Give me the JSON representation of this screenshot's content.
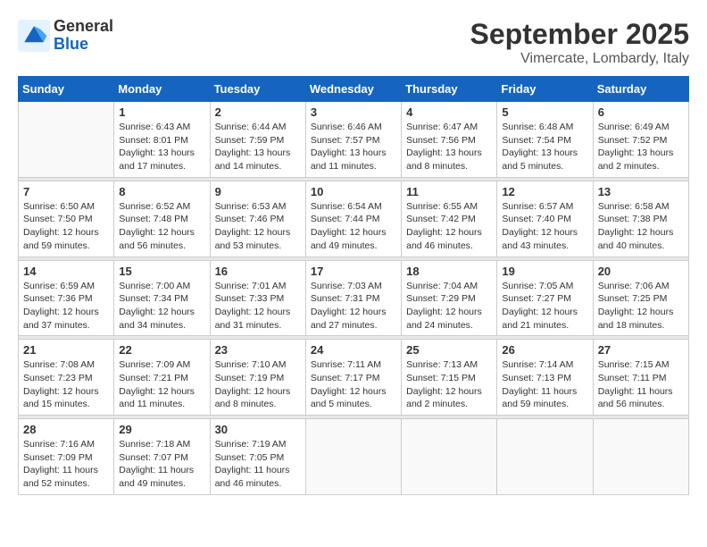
{
  "logo": {
    "general": "General",
    "blue": "Blue"
  },
  "title": "September 2025",
  "subtitle": "Vimercate, Lombardy, Italy",
  "days_of_week": [
    "Sunday",
    "Monday",
    "Tuesday",
    "Wednesday",
    "Thursday",
    "Friday",
    "Saturday"
  ],
  "weeks": [
    [
      {
        "day": "",
        "info": ""
      },
      {
        "day": "1",
        "info": "Sunrise: 6:43 AM\nSunset: 8:01 PM\nDaylight: 13 hours\nand 17 minutes."
      },
      {
        "day": "2",
        "info": "Sunrise: 6:44 AM\nSunset: 7:59 PM\nDaylight: 13 hours\nand 14 minutes."
      },
      {
        "day": "3",
        "info": "Sunrise: 6:46 AM\nSunset: 7:57 PM\nDaylight: 13 hours\nand 11 minutes."
      },
      {
        "day": "4",
        "info": "Sunrise: 6:47 AM\nSunset: 7:56 PM\nDaylight: 13 hours\nand 8 minutes."
      },
      {
        "day": "5",
        "info": "Sunrise: 6:48 AM\nSunset: 7:54 PM\nDaylight: 13 hours\nand 5 minutes."
      },
      {
        "day": "6",
        "info": "Sunrise: 6:49 AM\nSunset: 7:52 PM\nDaylight: 13 hours\nand 2 minutes."
      }
    ],
    [
      {
        "day": "7",
        "info": "Sunrise: 6:50 AM\nSunset: 7:50 PM\nDaylight: 12 hours\nand 59 minutes."
      },
      {
        "day": "8",
        "info": "Sunrise: 6:52 AM\nSunset: 7:48 PM\nDaylight: 12 hours\nand 56 minutes."
      },
      {
        "day": "9",
        "info": "Sunrise: 6:53 AM\nSunset: 7:46 PM\nDaylight: 12 hours\nand 53 minutes."
      },
      {
        "day": "10",
        "info": "Sunrise: 6:54 AM\nSunset: 7:44 PM\nDaylight: 12 hours\nand 49 minutes."
      },
      {
        "day": "11",
        "info": "Sunrise: 6:55 AM\nSunset: 7:42 PM\nDaylight: 12 hours\nand 46 minutes."
      },
      {
        "day": "12",
        "info": "Sunrise: 6:57 AM\nSunset: 7:40 PM\nDaylight: 12 hours\nand 43 minutes."
      },
      {
        "day": "13",
        "info": "Sunrise: 6:58 AM\nSunset: 7:38 PM\nDaylight: 12 hours\nand 40 minutes."
      }
    ],
    [
      {
        "day": "14",
        "info": "Sunrise: 6:59 AM\nSunset: 7:36 PM\nDaylight: 12 hours\nand 37 minutes."
      },
      {
        "day": "15",
        "info": "Sunrise: 7:00 AM\nSunset: 7:34 PM\nDaylight: 12 hours\nand 34 minutes."
      },
      {
        "day": "16",
        "info": "Sunrise: 7:01 AM\nSunset: 7:33 PM\nDaylight: 12 hours\nand 31 minutes."
      },
      {
        "day": "17",
        "info": "Sunrise: 7:03 AM\nSunset: 7:31 PM\nDaylight: 12 hours\nand 27 minutes."
      },
      {
        "day": "18",
        "info": "Sunrise: 7:04 AM\nSunset: 7:29 PM\nDaylight: 12 hours\nand 24 minutes."
      },
      {
        "day": "19",
        "info": "Sunrise: 7:05 AM\nSunset: 7:27 PM\nDaylight: 12 hours\nand 21 minutes."
      },
      {
        "day": "20",
        "info": "Sunrise: 7:06 AM\nSunset: 7:25 PM\nDaylight: 12 hours\nand 18 minutes."
      }
    ],
    [
      {
        "day": "21",
        "info": "Sunrise: 7:08 AM\nSunset: 7:23 PM\nDaylight: 12 hours\nand 15 minutes."
      },
      {
        "day": "22",
        "info": "Sunrise: 7:09 AM\nSunset: 7:21 PM\nDaylight: 12 hours\nand 11 minutes."
      },
      {
        "day": "23",
        "info": "Sunrise: 7:10 AM\nSunset: 7:19 PM\nDaylight: 12 hours\nand 8 minutes."
      },
      {
        "day": "24",
        "info": "Sunrise: 7:11 AM\nSunset: 7:17 PM\nDaylight: 12 hours\nand 5 minutes."
      },
      {
        "day": "25",
        "info": "Sunrise: 7:13 AM\nSunset: 7:15 PM\nDaylight: 12 hours\nand 2 minutes."
      },
      {
        "day": "26",
        "info": "Sunrise: 7:14 AM\nSunset: 7:13 PM\nDaylight: 11 hours\nand 59 minutes."
      },
      {
        "day": "27",
        "info": "Sunrise: 7:15 AM\nSunset: 7:11 PM\nDaylight: 11 hours\nand 56 minutes."
      }
    ],
    [
      {
        "day": "28",
        "info": "Sunrise: 7:16 AM\nSunset: 7:09 PM\nDaylight: 11 hours\nand 52 minutes."
      },
      {
        "day": "29",
        "info": "Sunrise: 7:18 AM\nSunset: 7:07 PM\nDaylight: 11 hours\nand 49 minutes."
      },
      {
        "day": "30",
        "info": "Sunrise: 7:19 AM\nSunset: 7:05 PM\nDaylight: 11 hours\nand 46 minutes."
      },
      {
        "day": "",
        "info": ""
      },
      {
        "day": "",
        "info": ""
      },
      {
        "day": "",
        "info": ""
      },
      {
        "day": "",
        "info": ""
      }
    ]
  ]
}
